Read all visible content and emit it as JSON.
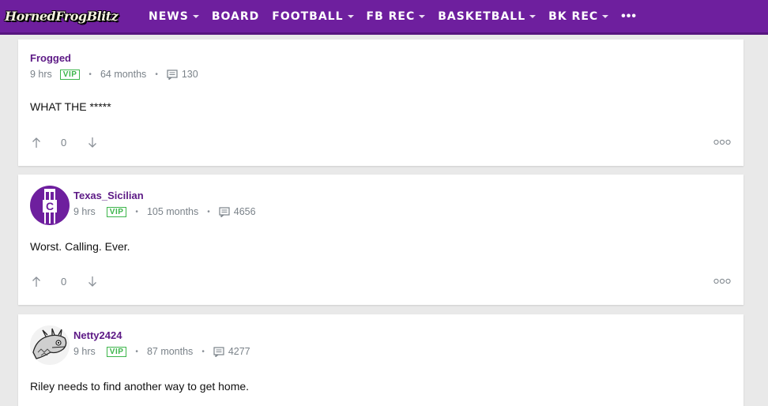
{
  "site": {
    "logo_text": "HornedFrogBlitz"
  },
  "nav": {
    "items": [
      {
        "label": "NEWS",
        "has_menu": true
      },
      {
        "label": "BOARD",
        "has_menu": false
      },
      {
        "label": "FOOTBALL",
        "has_menu": true
      },
      {
        "label": "FB REC",
        "has_menu": true
      },
      {
        "label": "BASKETBALL",
        "has_menu": true
      },
      {
        "label": "BK REC",
        "has_menu": true
      }
    ],
    "more_label": "•••"
  },
  "posts": [
    {
      "author": "Frogged",
      "time": "9 hrs",
      "badge": "VIP",
      "tenure": "64 months",
      "post_count": "130",
      "body": "WHAT THE *****",
      "score": "0",
      "avatar": null
    },
    {
      "author": "Texas_Sicilian",
      "time": "9 hrs",
      "badge": "VIP",
      "tenure": "105 months",
      "post_count": "4656",
      "body": "Worst. Calling. Ever.",
      "score": "0",
      "avatar": "tcu-c-logo"
    },
    {
      "author": "Netty2424",
      "time": "9 hrs",
      "badge": "VIP",
      "tenure": "87 months",
      "post_count": "4277",
      "body": "Riley needs to find another way to get home.",
      "avatar": "horned-frog-sketch"
    }
  ],
  "colors": {
    "brand_purple": "#6e1f9e",
    "author_purple": "#5d1a86",
    "vip_green": "#3cb54a",
    "meta_gray": "#7a8289"
  }
}
